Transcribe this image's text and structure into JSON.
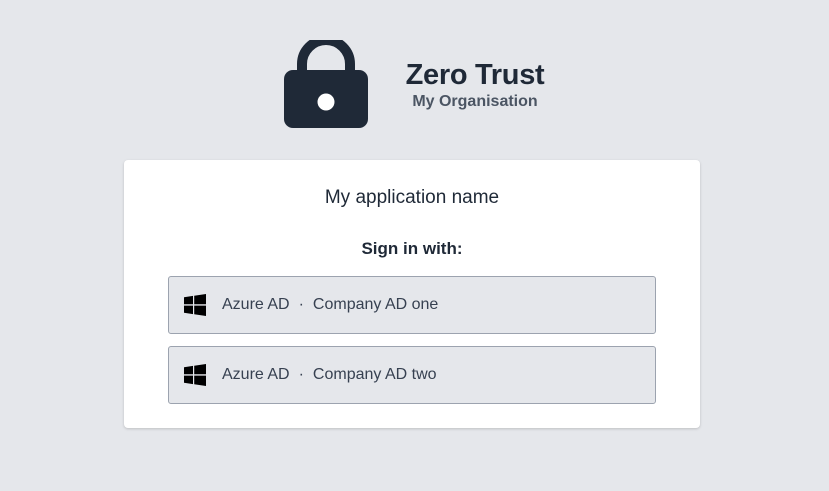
{
  "brand": {
    "title": "Zero Trust",
    "subtitle": "My Organisation",
    "icon": "lock-icon"
  },
  "card": {
    "app_name": "My application name",
    "sign_in_label": "Sign in with:",
    "providers": [
      {
        "icon": "windows-icon",
        "type": "Azure AD",
        "separator": "·",
        "name": "Company AD one"
      },
      {
        "icon": "windows-icon",
        "type": "Azure AD",
        "separator": "·",
        "name": "Company AD two"
      }
    ]
  },
  "colors": {
    "background": "#e5e7eb",
    "card": "#ffffff",
    "text_dark": "#1f2937",
    "icon_dark": "#1f2937"
  }
}
